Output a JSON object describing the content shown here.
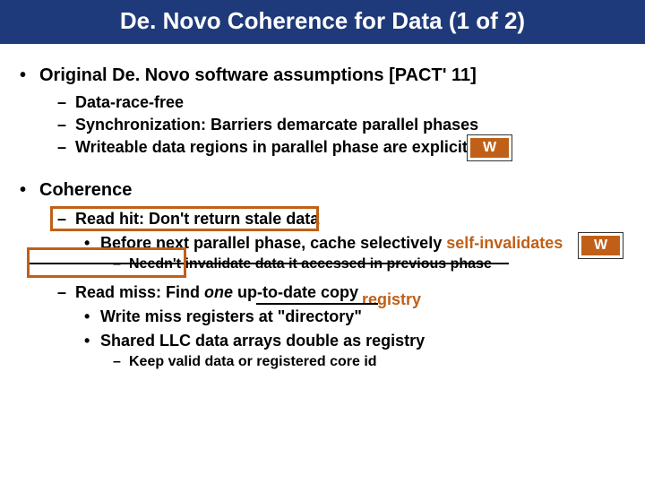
{
  "title": "De. Novo Coherence for Data (1 of 2)",
  "section1": {
    "heading": "Original De. Novo software assumptions [PACT' 11]",
    "items": [
      "Data-race-free",
      "Synchronization: Barriers demarcate parallel phases",
      "Writeable data regions in parallel phase are explicit"
    ]
  },
  "section2": {
    "heading": "Coherence",
    "read_hit": {
      "line": "Read hit: Don't return stale data",
      "sub1a": "Before next parallel phase, cache selectively ",
      "sub1b": "self-invalidates",
      "sub2": "Needn't invalidate data it accessed in previous phase"
    },
    "read_miss": {
      "line_a": "Read miss: Find ",
      "line_b": "one",
      "line_c": " up-to-date copy",
      "registry": "registry",
      "sub1": "Write miss registers at \"directory\"",
      "sub2": "Shared LLC data arrays double as registry",
      "sub3": "Keep valid data or registered core id"
    }
  },
  "wlabel": "W"
}
